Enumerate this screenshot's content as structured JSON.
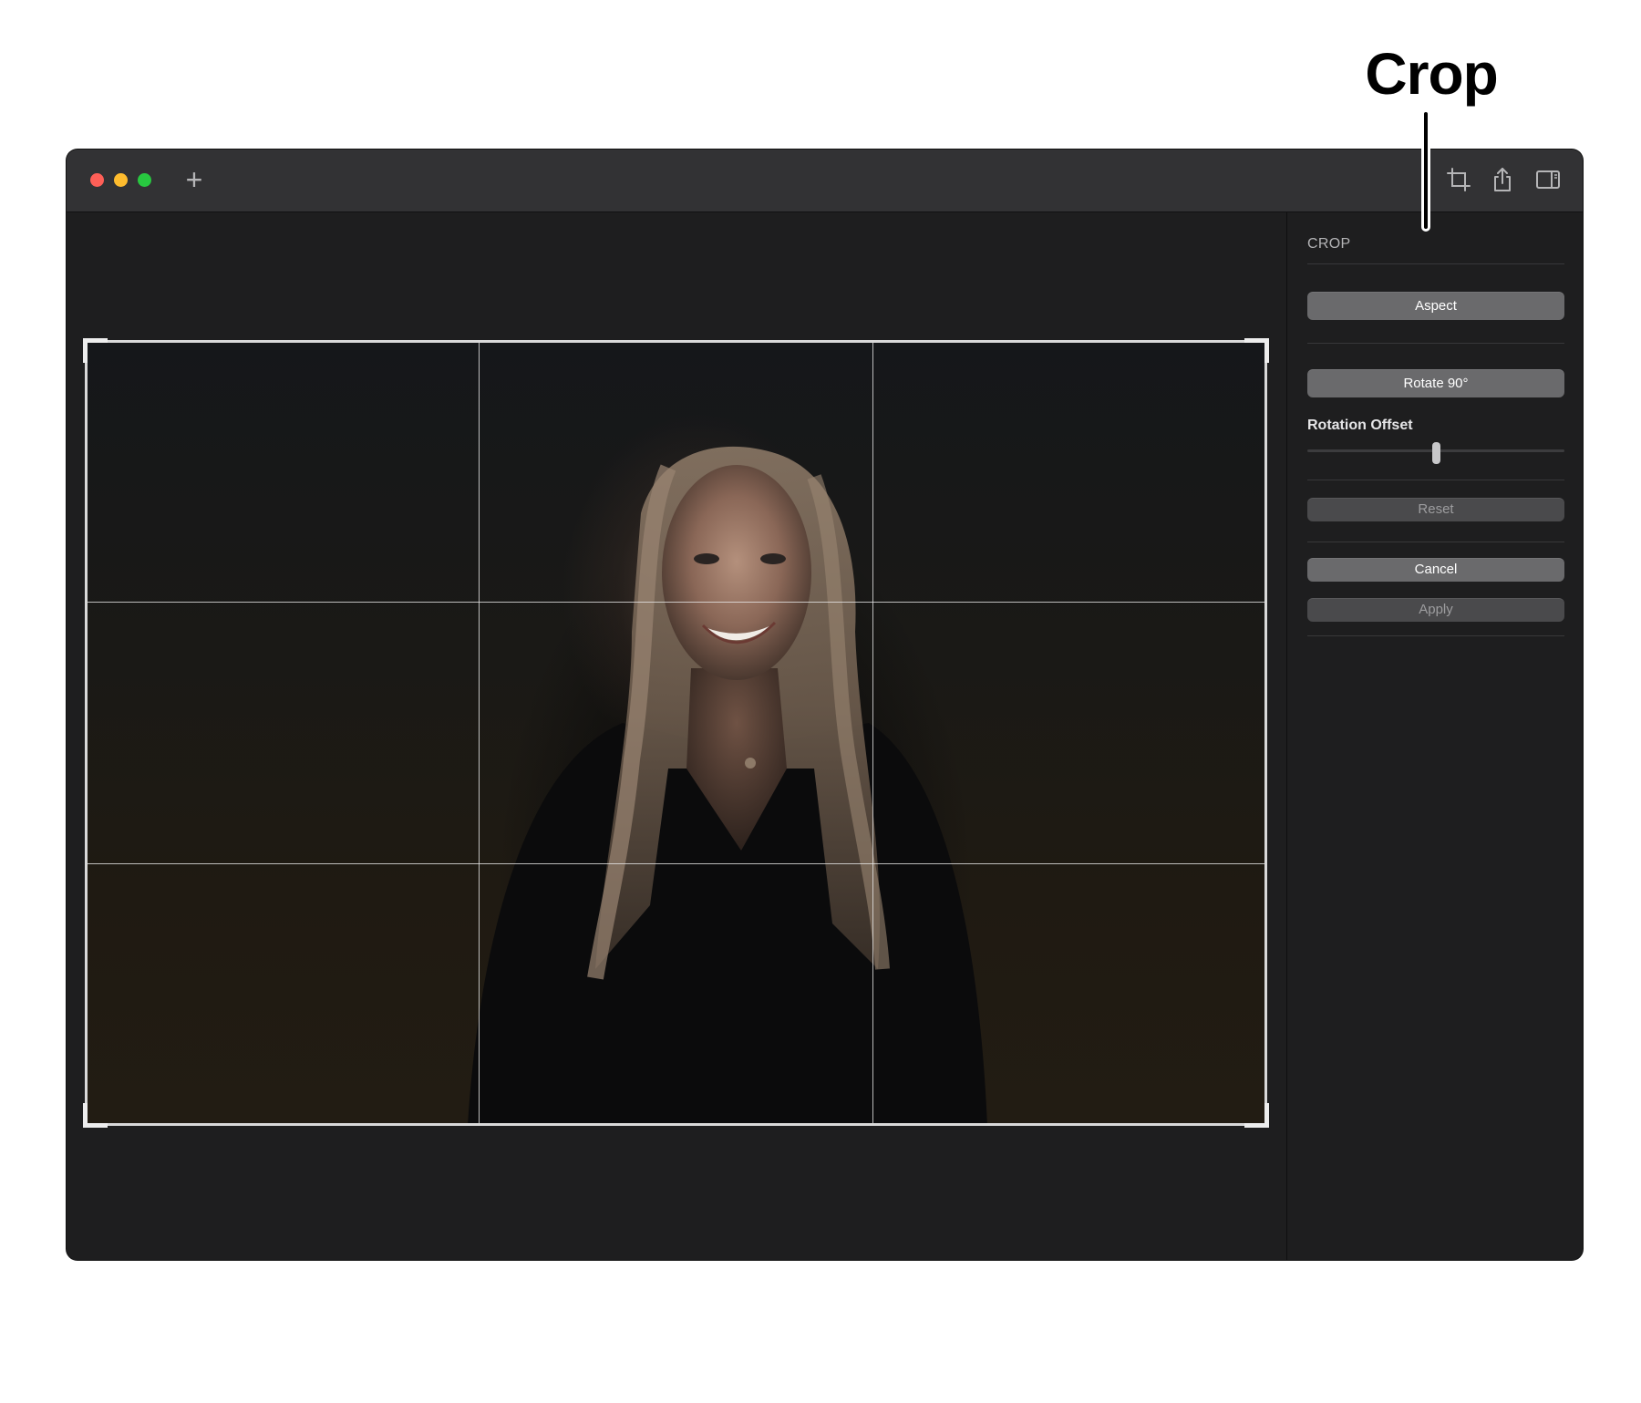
{
  "callout": {
    "label": "Crop"
  },
  "window": {
    "new_tab_symbol": "+",
    "toolbar_icons": [
      "crop-icon",
      "share-icon",
      "sidebar-icon"
    ]
  },
  "inspector": {
    "title": "CROP",
    "aspect_label": "Aspect",
    "rotate_label": "Rotate 90°",
    "rotation_offset_label": "Rotation Offset",
    "rotation_offset_value": 0.5,
    "reset_label": "Reset",
    "cancel_label": "Cancel",
    "apply_label": "Apply"
  },
  "crop": {
    "grid": "rule-of-thirds"
  },
  "colors": {
    "close": "#fe5f57",
    "minimize": "#febc2e",
    "maximize": "#28c840",
    "window_bg": "#1e1e1f",
    "titlebar_bg": "#323234"
  }
}
